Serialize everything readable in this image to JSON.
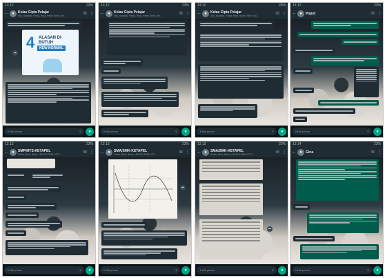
{
  "colors": {
    "header": "#1f2c34",
    "incoming_bubble": "#1f2c34",
    "outgoing_bubble": "#005c4b",
    "accent": "#00a884",
    "text_primary": "#e9edef",
    "text_secondary": "#8696a0"
  },
  "phones": [
    {
      "time": "13.12",
      "battery": "23%",
      "title": "Kelas Cipta Pelajar",
      "subtitle": "Abu, risdwan, Pasla, Rina, Irwan, Nbax, Bu...",
      "avatar_icon": "group-avatar-icon",
      "poster_number": "4",
      "poster_title_1": "ALASAN DI",
      "poster_title_2": "BUTUH",
      "poster_ribbon": "NEW NORMAL",
      "composer_placeholder": "Ketik pesan"
    },
    {
      "time": "13.12",
      "battery": "23%",
      "title": "Kelas Cipta Pelajar",
      "subtitle": "Abu, risdwan, Pasla, Rina, Irwan, Nbax, Bu...",
      "avatar_icon": "group-avatar-icon",
      "composer_placeholder": "Ketik pesan"
    },
    {
      "time": "13.12",
      "battery": "23%",
      "title": "Kelas Cipta Pelajar",
      "subtitle": "Abu, risdwan, Pasla, Rina, Irwan, Nbax, Bu...",
      "avatar_icon": "group-avatar-icon",
      "composer_placeholder": "Ketik pesan"
    },
    {
      "time": "13.12",
      "battery": "23%",
      "title": "Puput",
      "subtitle": "",
      "avatar_icon": "contact-avatar-icon",
      "composer_placeholder": "Ketik pesan"
    },
    {
      "time": "13.13",
      "battery": "23%",
      "title": "SMP/MTS-KETAPEL",
      "subtitle": "Pasla, Rina, Bima, +62 813-2554-0771...",
      "avatar_icon": "group-avatar-icon",
      "composer_placeholder": "Ketik pesan"
    },
    {
      "time": "13.13",
      "battery": "23%",
      "title": "SMA/SMK-KETAPEL",
      "subtitle": "Pasla, Rina, Bima, +62 813-2554-0771...",
      "avatar_icon": "group-avatar-icon",
      "composer_placeholder": "Ketik pesan"
    },
    {
      "time": "13.13",
      "battery": "23%",
      "title": "SMA/SMK-KETAPEL",
      "subtitle": "Pasla, Rina, Bima, +62 813-2554-0771...",
      "avatar_icon": "group-avatar-icon",
      "composer_placeholder": "Ketik pesan"
    },
    {
      "time": "13.14",
      "battery": "23%",
      "title": "Gina",
      "subtitle": "",
      "avatar_icon": "contact-avatar-icon",
      "composer_placeholder": "Ketik pesan"
    }
  ],
  "icons": {
    "back": "arrow-left-icon",
    "call": "phone-icon",
    "menu": "more-vert-icon",
    "emoji": "emoji-icon",
    "attach": "paperclip-icon",
    "camera": "camera-icon",
    "mic": "microphone-icon"
  }
}
